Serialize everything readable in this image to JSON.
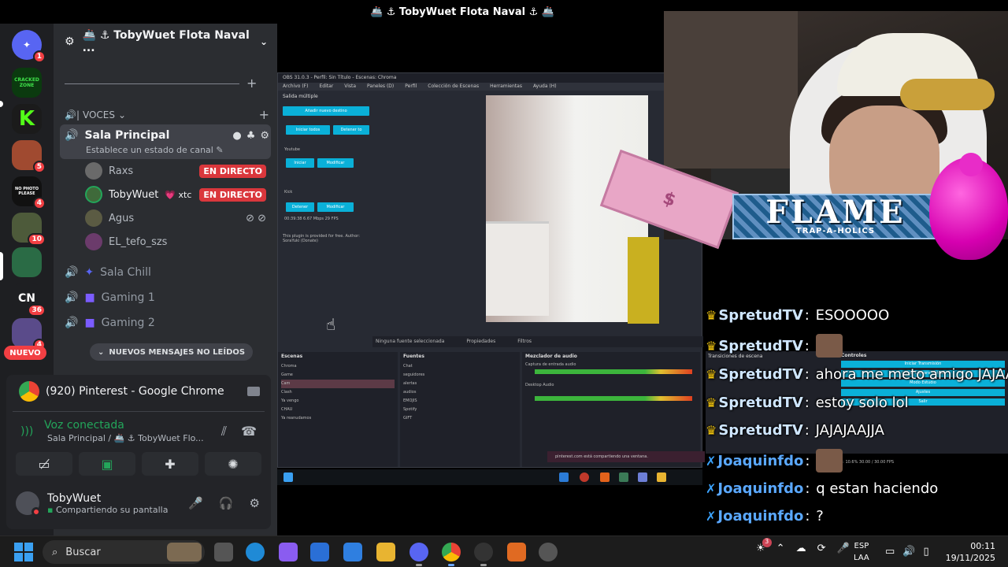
{
  "window": {
    "title": "🚢 ⚓ TobyWuet Flota Naval ⚓ 🚢"
  },
  "guild": {
    "name": "🚢 ⚓ TobyWuet Flota Naval ..."
  },
  "servers": [
    {
      "name": "discord-home",
      "badge": "1"
    },
    {
      "name": "cracked-zone",
      "label": "CRACKED ZONE",
      "badge": ""
    },
    {
      "name": "kick",
      "label": "K",
      "badge": ""
    },
    {
      "name": "server-3",
      "badge": "5"
    },
    {
      "name": "no-photo",
      "label": "NO PHOTO PLEASE",
      "badge": "4"
    },
    {
      "name": "server-5",
      "badge": "10"
    },
    {
      "name": "server-6",
      "badge": ""
    },
    {
      "name": "cn",
      "label": "CN",
      "badge": "36"
    },
    {
      "name": "server-8",
      "badge": "4"
    }
  ],
  "new_badge": "NUEVO",
  "category": {
    "label": "VOCES"
  },
  "channels": {
    "main": {
      "name": "Sala Principal",
      "status": "Establece un estado de canal"
    },
    "chill": "Sala Chill",
    "gaming1": "Gaming 1",
    "gaming2": "Gaming 2"
  },
  "users": [
    {
      "name": "Raxs",
      "live": "EN DIRECTO",
      "tag": ""
    },
    {
      "name": "TobyWuet",
      "live": "EN DIRECTO",
      "tag": "💗 xtc"
    },
    {
      "name": "Agus",
      "live": "",
      "tag": ""
    },
    {
      "name": "EL_tefo_szs",
      "live": "",
      "tag": ""
    }
  ],
  "unread_pill": "NUEVOS MENSAJES NO LEÍDOS",
  "panel": {
    "stream_title": "(920) Pinterest - Google Chrome",
    "voice_status": "Voz conectada",
    "voice_location": "Sala Principal / 🚢 ⚓ TobyWuet Flo...",
    "me_name": "TobyWuet",
    "me_status": "Compartiendo su pantalla"
  },
  "obs": {
    "title": "OBS 31.0.3 - Perfil: Sin Título - Escenas: Chroma",
    "menu": [
      "Archivo (F)",
      "Editar",
      "Vista",
      "Paneles (D)",
      "Perfil",
      "Colección de Escenas",
      "Herramientas",
      "Ayuda (H)"
    ],
    "dock_title": "Salida múltiple",
    "add_btn": "Añadir nuevo destino",
    "start_all": "Iniciar todos",
    "stop_all": "Detener to",
    "youtube": "Youtube",
    "kick": "Kick",
    "start": "Iniciar",
    "modify": "Modificar",
    "stop": "Detener",
    "stats": "00:39:38  6.67 Mbps  29 FPS",
    "plugin_note": "This plugin is provided for free. Author: SoraYuki (Donate)",
    "no_source": "Ninguna fuente seleccionada",
    "properties": "Propiedades",
    "filters": "Filtros",
    "scenes_title": "Escenas",
    "scenes": [
      "Chroma",
      "Game",
      "Cam",
      "Clash",
      "Ya vengo",
      "CHAU",
      "Ya reanudamos"
    ],
    "sources_title": "Fuentes",
    "sources": [
      "Chat",
      "seguidores",
      "alertas",
      "audios",
      "EMOJIS",
      "Spotify",
      "GIFT"
    ],
    "mixer_title": "Mezclador de audio",
    "mixer_ch1": "Captura de entrada audio",
    "mixer_ch2": "Desktop Audio",
    "transitions_title": "Transiciones de escena",
    "controls_title": "Controles",
    "controls": [
      "Iniciar Transmisión",
      "Iniciar Cámara Virtual",
      "Modo Estudio",
      "Ajustes",
      "Salir"
    ],
    "share_notice": "pinterest.com está compartiendo una ventana.",
    "status": "CPU: 10.6%  30.00 / 30.00 FPS"
  },
  "overlay": {
    "flame": "FLAME",
    "flame_sub": "TRAP-A-HOLICS"
  },
  "chat": [
    {
      "user": "SpretudTV",
      "badge": "crown",
      "msg": "ESOOOOO",
      "emote": false
    },
    {
      "user": "SpretudTV",
      "badge": "crown",
      "msg": "",
      "emote": true
    },
    {
      "user": "SpretudTV",
      "badge": "crown",
      "msg": "ahora me meto amigo JAJAA",
      "emote": false
    },
    {
      "user": "SpretudTV",
      "badge": "crown",
      "msg": "estoy solo lol",
      "emote": false
    },
    {
      "user": "SpretudTV",
      "badge": "crown",
      "msg": "JAJAJAAJJA",
      "emote": false
    },
    {
      "user": "Joaquinfdo",
      "badge": "sword",
      "msg": "",
      "emote": true
    },
    {
      "user": "Joaquinfdo",
      "badge": "sword",
      "msg": "q estan haciendo",
      "emote": false
    },
    {
      "user": "Joaquinfdo",
      "badge": "sword",
      "msg": "?",
      "emote": false
    }
  ],
  "taskbar": {
    "search_placeholder": "Buscar",
    "lang1": "ESP",
    "lang2": "LAA",
    "time": "00:11",
    "date": "19/11/2025",
    "notification_count": "3"
  },
  "colors": {
    "accent": "#5865f2",
    "live": "#da373c",
    "voice": "#23a55a",
    "chat_name": "#cfe6ff",
    "crown": "#f1c40f"
  }
}
